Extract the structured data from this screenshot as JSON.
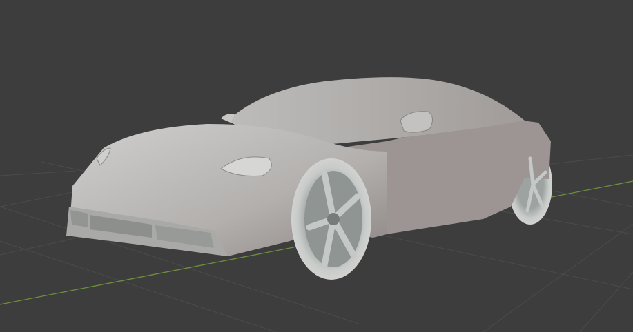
{
  "viewport": {
    "shading": "solid",
    "model": "car",
    "colors": {
      "background": "#3d3d3d",
      "grid": "#4b4b4b",
      "x_axis": "#6e8f3c",
      "body": "#bdbcbb",
      "body_shadow": "#8d8887",
      "wheel": "#aeb2b0"
    }
  }
}
